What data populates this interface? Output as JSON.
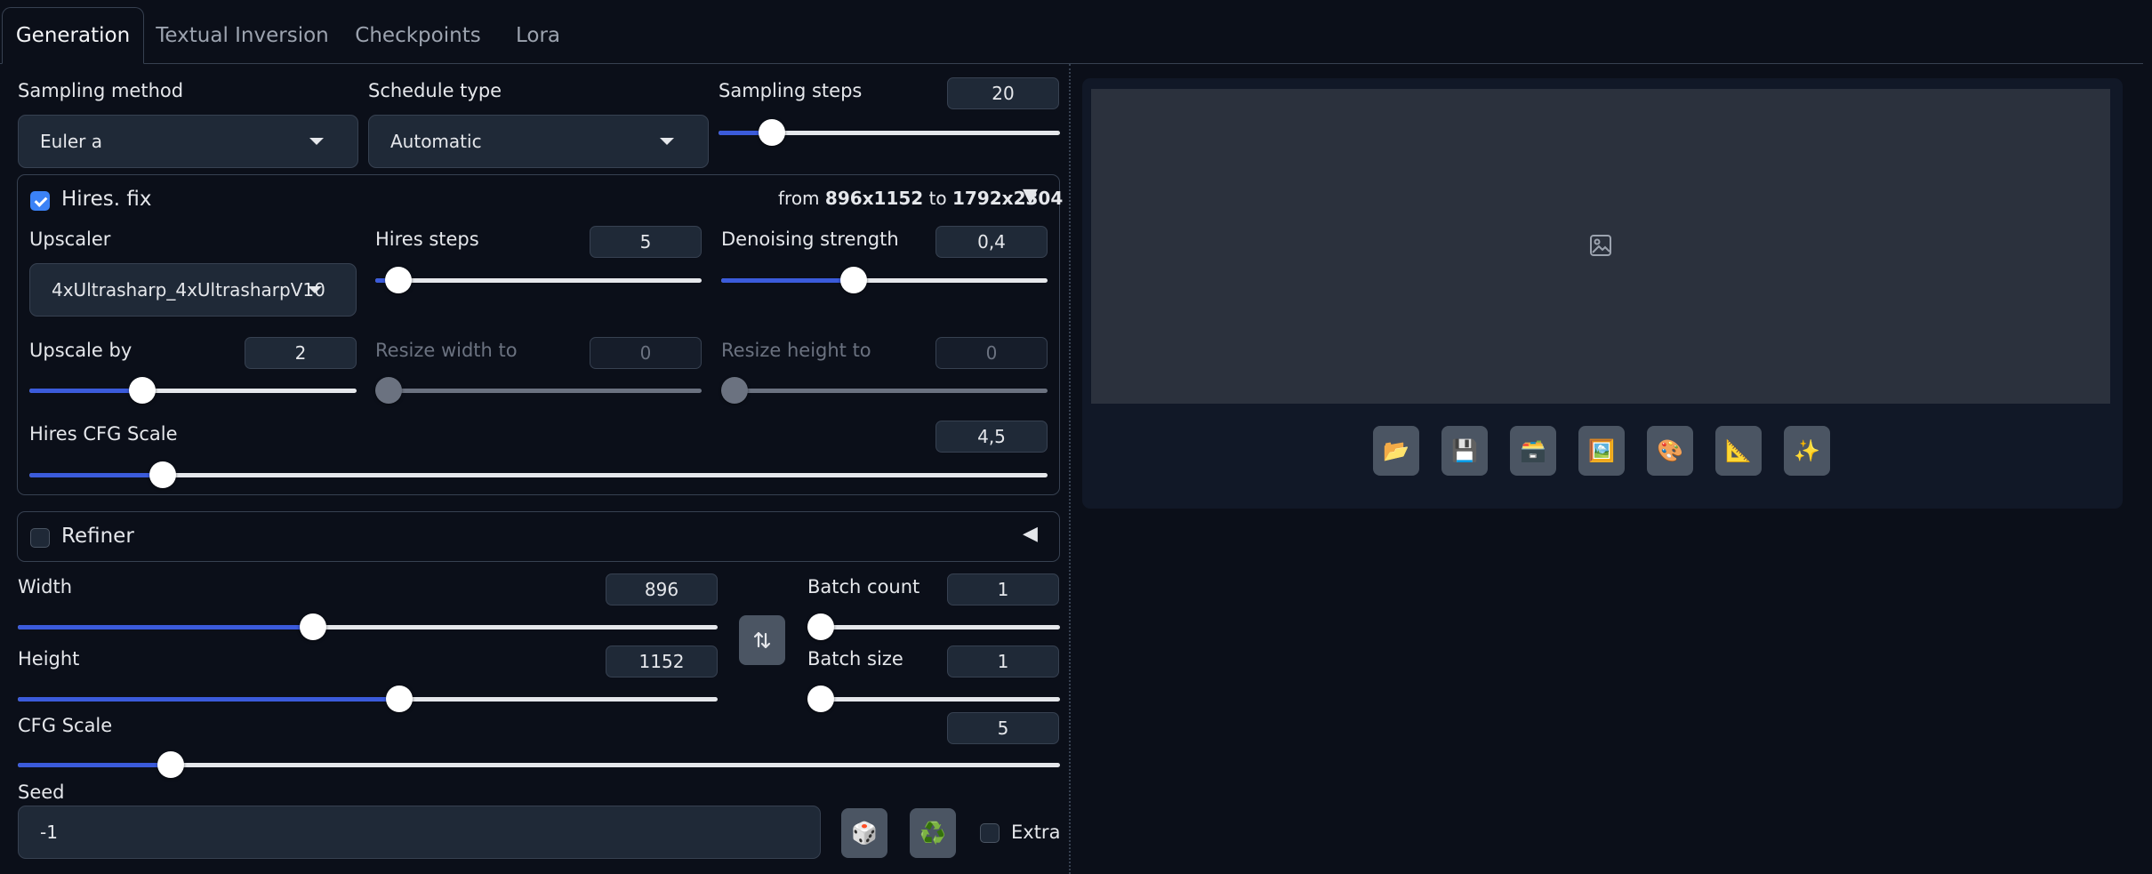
{
  "tabs": [
    {
      "label": "Generation",
      "active": true
    },
    {
      "label": "Textual Inversion",
      "active": false
    },
    {
      "label": "Checkpoints",
      "active": false
    },
    {
      "label": "Lora",
      "active": false
    }
  ],
  "sampling": {
    "method_label": "Sampling method",
    "method_value": "Euler a",
    "schedule_label": "Schedule type",
    "schedule_value": "Automatic",
    "steps_label": "Sampling steps",
    "steps_value": "20"
  },
  "hires": {
    "checked": true,
    "label": "Hires. fix",
    "from_text": "from ",
    "from_size": "896x1152",
    "to_text": " to ",
    "to_size": "1792x2304",
    "toggle_icon": "▼",
    "upscaler_label": "Upscaler",
    "upscaler_value": "4xUltrasharp_4xUltrasharpV10",
    "steps_label": "Hires steps",
    "steps_value": "5",
    "denoise_label": "Denoising strength",
    "denoise_value": "0,4",
    "upscale_by_label": "Upscale by",
    "upscale_by_value": "2",
    "resize_width_label": "Resize width to",
    "resize_width_value": "0",
    "resize_height_label": "Resize height to",
    "resize_height_value": "0",
    "cfg_label": "Hires CFG Scale",
    "cfg_value": "4,5"
  },
  "refiner": {
    "checked": false,
    "label": "Refiner",
    "toggle_icon": "◀"
  },
  "dims": {
    "width_label": "Width",
    "width_value": "896",
    "height_label": "Height",
    "height_value": "1152",
    "swap_icon": "swap-icon",
    "batch_count_label": "Batch count",
    "batch_count_value": "1",
    "batch_size_label": "Batch size",
    "batch_size_value": "1",
    "cfg_label": "CFG Scale",
    "cfg_value": "5"
  },
  "seed": {
    "label": "Seed",
    "value": "-1",
    "dice_icon": "🎲",
    "recycle_icon": "♻️",
    "extra_label": "Extra",
    "extra_checked": false
  },
  "output": {
    "image_placeholder_icon": "image-icon",
    "buttons": [
      {
        "name": "folder-icon",
        "glyph": "📂"
      },
      {
        "name": "save-icon",
        "glyph": "💾"
      },
      {
        "name": "zip-icon",
        "glyph": "🗃️"
      },
      {
        "name": "send-to-img2img-icon",
        "glyph": "🖼️"
      },
      {
        "name": "send-to-inpaint-icon",
        "glyph": "🎨"
      },
      {
        "name": "send-to-extras-icon",
        "glyph": "📐"
      },
      {
        "name": "sparkles-icon",
        "glyph": "✨"
      }
    ]
  },
  "colors": {
    "background": "#0b0f19",
    "slider_fill": "#3b5bdb",
    "checkbox_on": "#3b82f6"
  }
}
